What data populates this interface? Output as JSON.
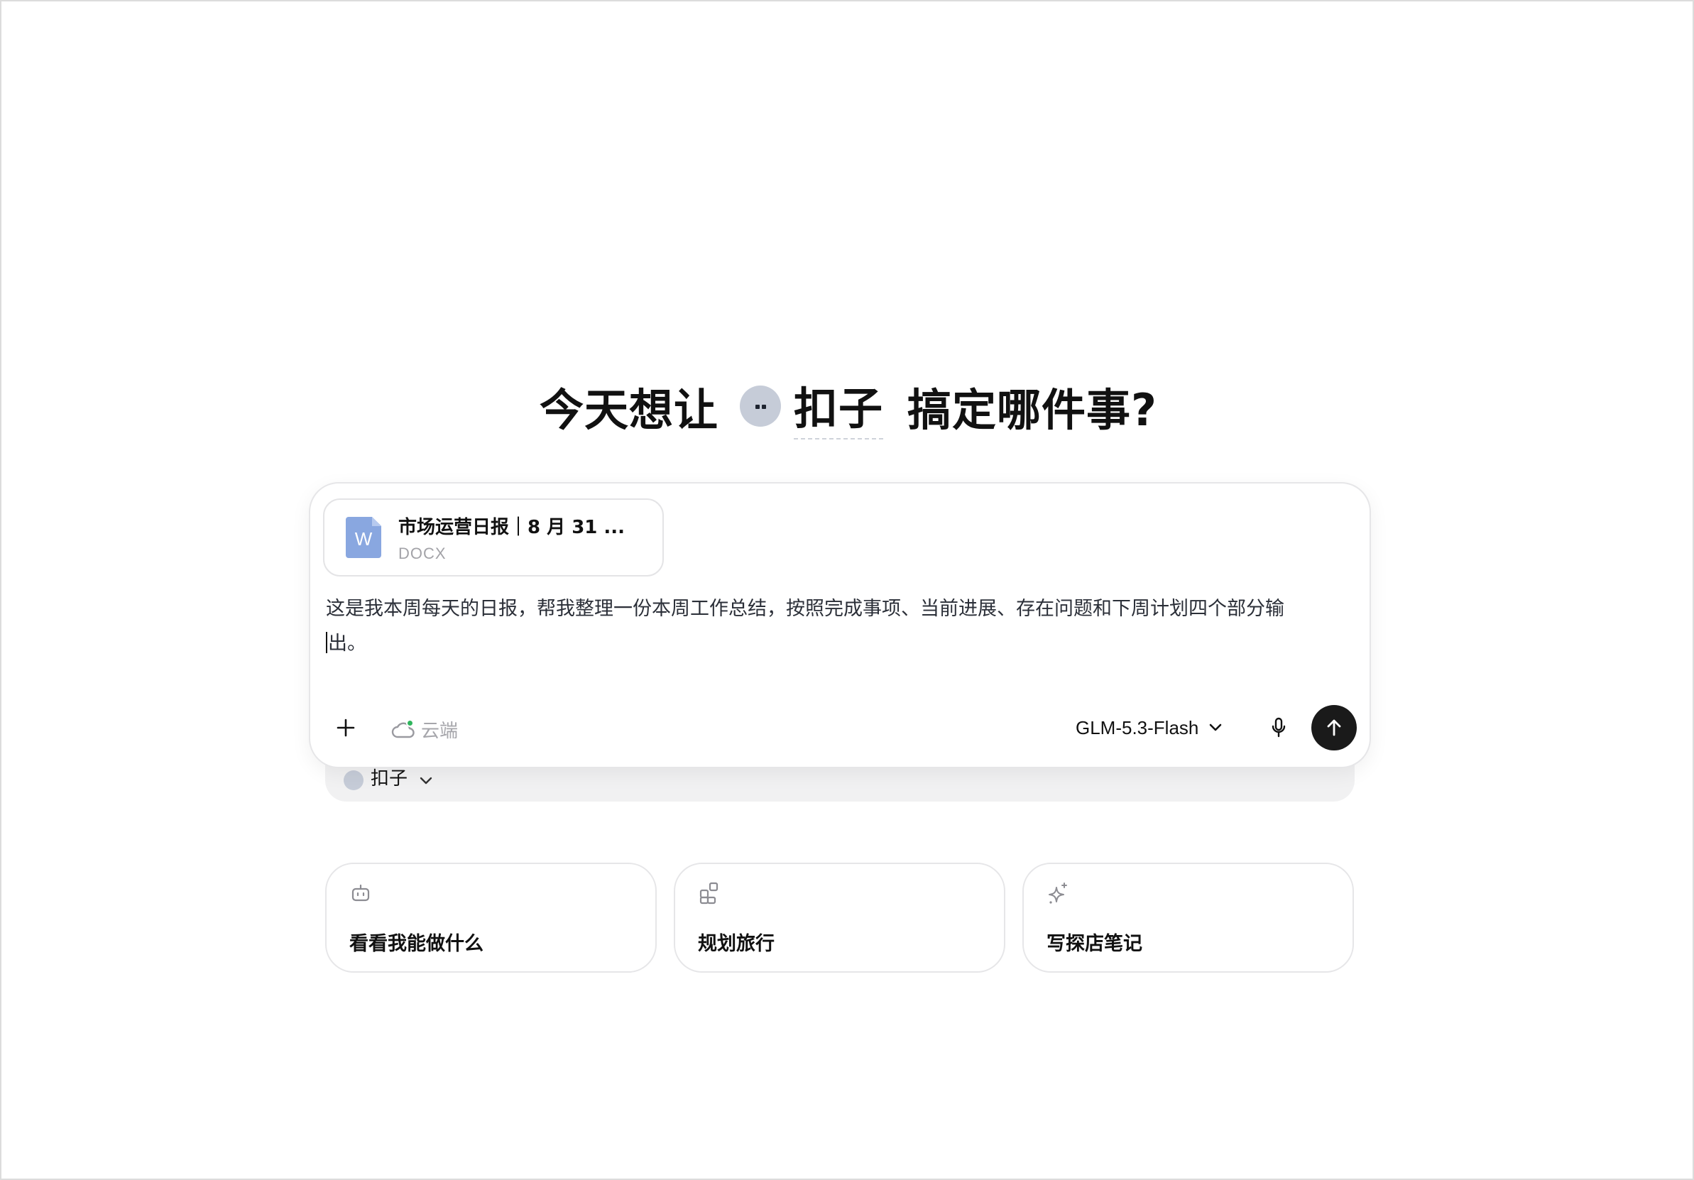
{
  "headline": {
    "prefix": "今天想让",
    "agent": "扣子",
    "suffix": "搞定哪件事?"
  },
  "attachment": {
    "title": "市场运营日报｜8 月 31 ...",
    "type": "DOCX",
    "icon": "word-doc-icon",
    "icon_letter": "W"
  },
  "prompt": {
    "line1": "这是我本周每天的日报，帮我整理一份本周工作总结，按照完成事项、当前进展、存在问题和下周计划四个部分输",
    "line2": "出。"
  },
  "toolbar": {
    "add_icon": "plus-icon",
    "cloud_label": "云端",
    "cloud_status_color": "#2fb55d",
    "model_name": "GLM-5.3-Flash",
    "mic_icon": "microphone-icon",
    "send_icon": "arrow-up-icon"
  },
  "agent_selector": {
    "label": "扣子"
  },
  "suggestions": [
    {
      "icon": "robot-icon",
      "label": "看看我能做什么"
    },
    {
      "icon": "apps-grid-icon",
      "label": "规划旅行"
    },
    {
      "icon": "sparkle-icon",
      "label": "写探店笔记"
    }
  ],
  "colors": {
    "send_button": "#1a1a1a",
    "avatar": "#c6ccd8",
    "doc_icon": "#89a7e0"
  }
}
